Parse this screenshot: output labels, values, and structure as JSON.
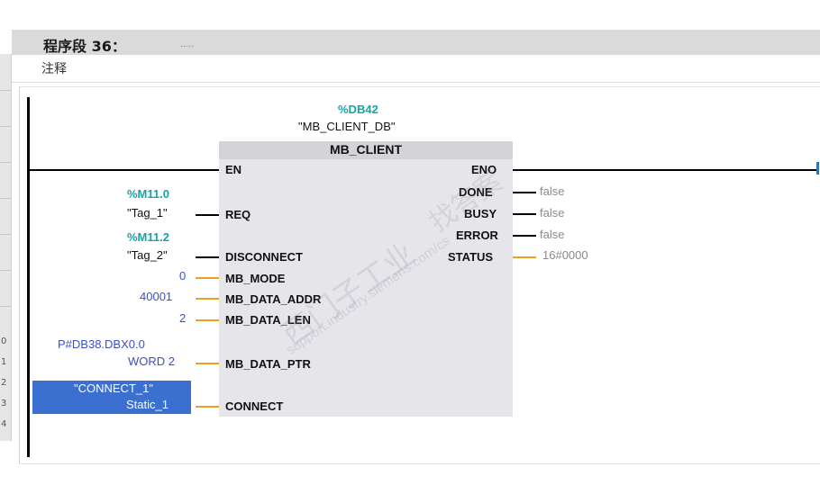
{
  "network": {
    "title": "程序段 36：",
    "dots": ".....",
    "comment": "注释"
  },
  "gutter_numbers": [
    "0",
    "1",
    "2",
    "3",
    "4"
  ],
  "instance": {
    "address": "%DB42",
    "name": "\"MB_CLIENT_DB\""
  },
  "block": {
    "name": "MB_CLIENT",
    "inputs": {
      "en": "EN",
      "req": "REQ",
      "disconnect": "DISCONNECT",
      "mb_mode": "MB_MODE",
      "mb_data_addr": "MB_DATA_ADDR",
      "mb_data_len": "MB_DATA_LEN",
      "mb_data_ptr": "MB_DATA_PTR",
      "connect": "CONNECT"
    },
    "outputs": {
      "eno": "ENO",
      "done": "DONE",
      "busy": "BUSY",
      "error": "ERROR",
      "status": "STATUS"
    }
  },
  "params": {
    "req_addr": "%M11.0",
    "req_tag": "\"Tag_1\"",
    "disc_addr": "%M11.2",
    "disc_tag": "\"Tag_2\"",
    "mb_mode": "0",
    "mb_data_addr": "40001",
    "mb_data_len": "2",
    "ptr_line1": "P#DB38.DBX0.0",
    "ptr_line2": "WORD 2",
    "connect_line1": "\"CONNECT_1\"",
    "connect_line2": "Static_1",
    "done_val": "false",
    "busy_val": "false",
    "error_val": "false",
    "status_val": "16#0000"
  },
  "watermark": {
    "cn1": "西门子工业",
    "cn2": "找答案",
    "url": "support.industry.siemens.com/cs"
  }
}
